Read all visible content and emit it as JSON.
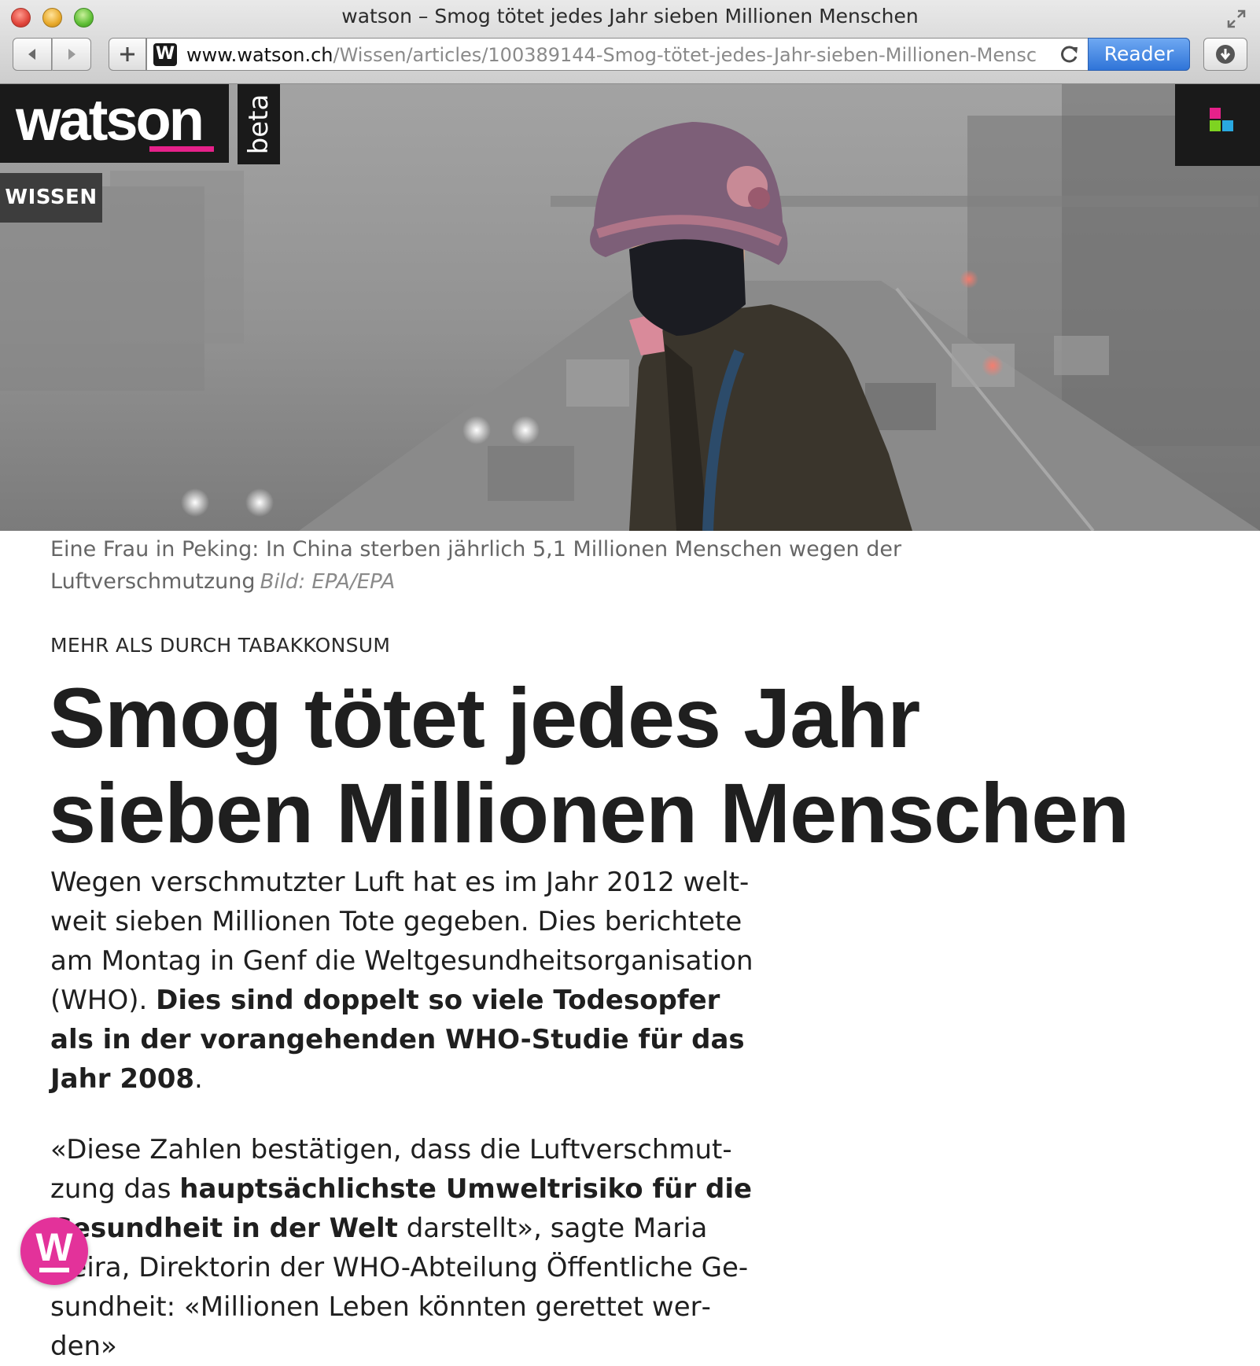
{
  "window": {
    "title": "watson – Smog tötet jedes Jahr sieben Millionen Menschen"
  },
  "toolbar": {
    "url_host": "www.watson.ch",
    "url_path": "/Wissen/articles/100389144-Smog-tötet-jedes-Jahr-sieben-Millionen-Mensc",
    "favicon_letter": "W",
    "reader_label": "Reader"
  },
  "site": {
    "logo_text": "watson",
    "beta_label": "beta",
    "section_label": "WISSEN",
    "brand_color": "#e6218a",
    "menu_squares": [
      "#e6218a",
      "#7ed321",
      "#29a9e1",
      "#ffffff"
    ]
  },
  "article": {
    "caption": "Eine Frau in Peking: In China sterben jährlich 5,1 Millionen Menschen wegen der Luftverschmutzung",
    "credit": "Bild: EPA/EPA",
    "kicker": "MEHR ALS DURCH TABAKKONSUM",
    "headline_line1": "Smog tötet jedes Jahr",
    "headline_line2": "sieben Millionen Menschen",
    "para1_plain": "Wegen verschmutzter Luft hat es im Jahr 2012 welt­weit sieben Millionen Tote gegeben. Dies berichtete am Montag in Genf die Weltgesundheitsorganisati­on (WHO). ",
    "para1_bold": "Dies sind doppelt so viele Todesopfer als in der vorangehenden WHO-Studie für das Jahr 2008",
    "para1_end": ".",
    "para2_a": "«Diese Zahlen bestätigen, dass die Luftverschmut­zung das ",
    "para2_bold": "hauptsächlichste Umweltrisiko für die Gesundheit in der Welt",
    "para2_b": " darstellt», sagte Maria Nei­ra, Direktorin der WHO-Abteilung Öffentliche Ge­sundheit: «Millionen Leben könnten gerettet wer­den»"
  },
  "fab": {
    "letter": "W"
  }
}
